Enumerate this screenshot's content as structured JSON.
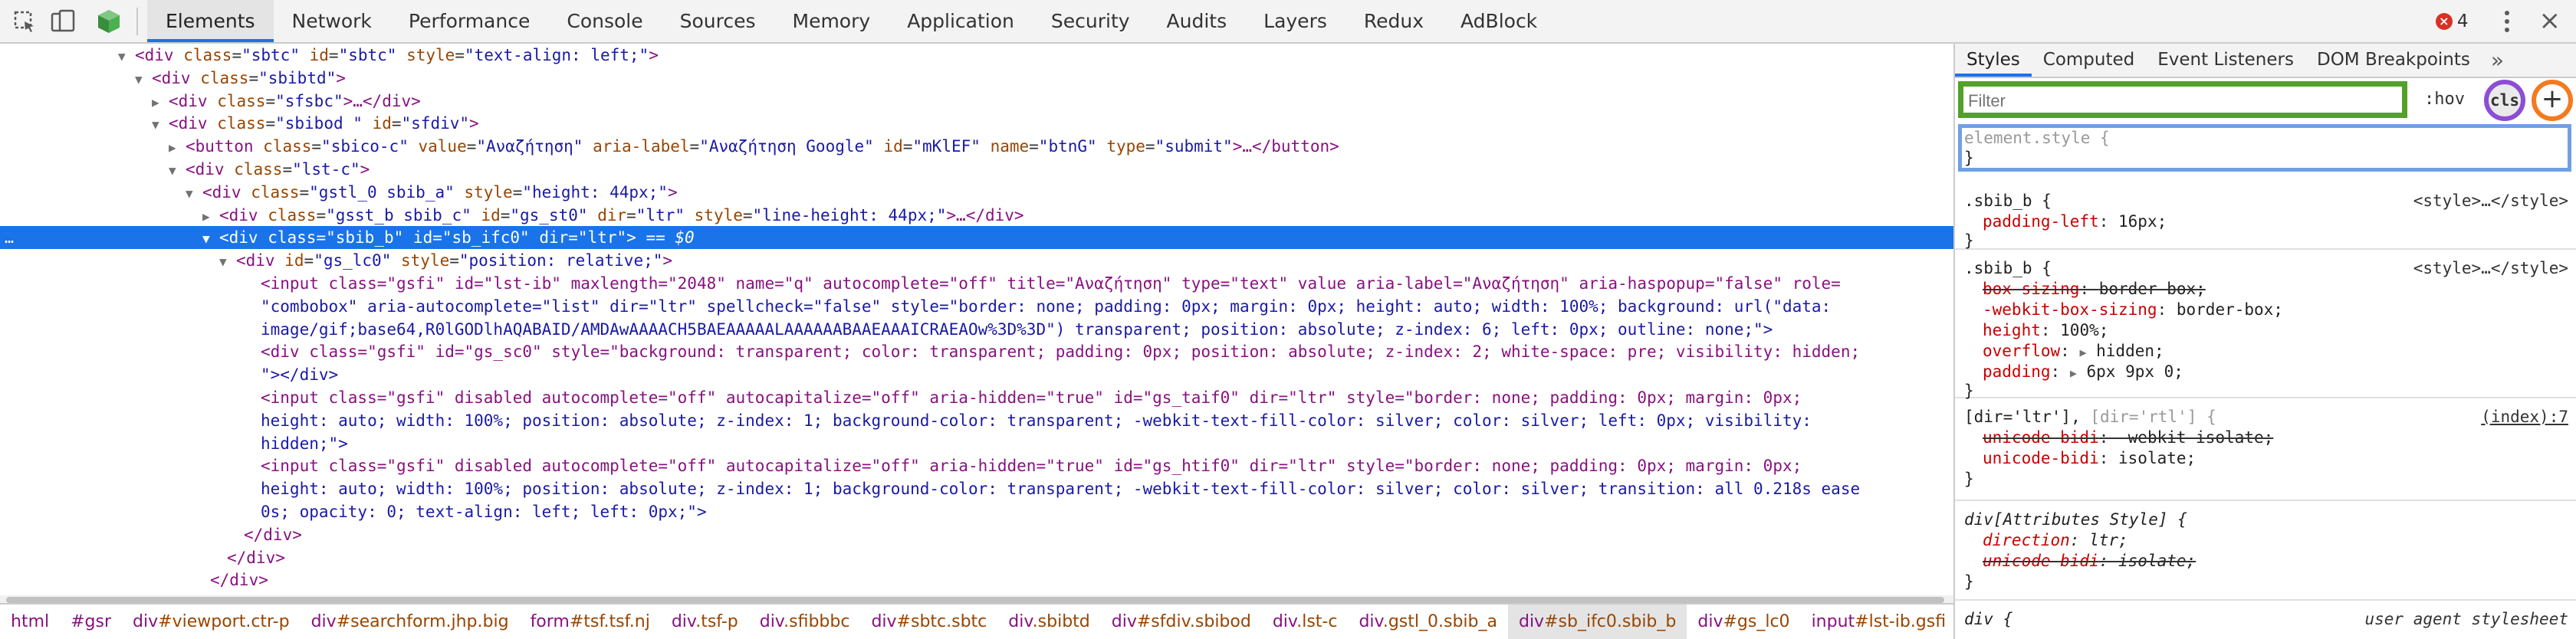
{
  "toolbar": {
    "tabs": [
      "Elements",
      "Network",
      "Performance",
      "Console",
      "Sources",
      "Memory",
      "Application",
      "Security",
      "Audits",
      "Layers",
      "Redux",
      "AdBlock"
    ],
    "active_tab": "Elements",
    "error_count": "4"
  },
  "dom": {
    "lines": [
      {
        "tag": "div",
        "attrs": [
          [
            "class",
            "sbtc"
          ],
          [
            "id",
            "sbtc"
          ],
          [
            "style",
            "text-align: left;"
          ]
        ],
        "close": ">"
      },
      {
        "tag": "div",
        "attrs": [
          [
            "class",
            "sbibtd"
          ]
        ],
        "close": ">"
      },
      {
        "tag": "div",
        "attrs": [
          [
            "class",
            "sfsbc"
          ]
        ],
        "close": ">…</div>"
      },
      {
        "tag": "div",
        "attrs": [
          [
            "class",
            "sbibod "
          ],
          [
            "id",
            "sfdiv"
          ]
        ],
        "close": ">"
      },
      {
        "tag": "button",
        "attrs": [
          [
            "class",
            "sbico-c"
          ],
          [
            "value",
            "Αναζήτηση"
          ],
          [
            "aria-label",
            "Αναζήτηση Google"
          ],
          [
            "id",
            "mKlEF"
          ],
          [
            "name",
            "btnG"
          ],
          [
            "type",
            "submit"
          ]
        ],
        "close": ">…</button>"
      },
      {
        "tag": "div",
        "attrs": [
          [
            "class",
            "lst-c"
          ]
        ],
        "close": ">"
      },
      {
        "tag": "div",
        "attrs": [
          [
            "class",
            "gstl_0 sbib_a"
          ],
          [
            "style",
            "height: 44px;"
          ]
        ],
        "close": ">"
      },
      {
        "tag": "div",
        "attrs": [
          [
            "class",
            "gsst_b sbib_c"
          ],
          [
            "id",
            "gs_st0"
          ],
          [
            "dir",
            "ltr"
          ],
          [
            "style",
            "line-height: 44px;"
          ]
        ],
        "close": ">…</div>"
      },
      {
        "tag": "div",
        "attrs": [
          [
            "class",
            "sbib_b"
          ],
          [
            "id",
            "sb_ifc0"
          ],
          [
            "dir",
            "ltr"
          ]
        ],
        "close": ">",
        "suffix": " == $0"
      },
      {
        "tag": "div",
        "attrs": [
          [
            "id",
            "gs_lc0"
          ],
          [
            "style",
            "position: relative;"
          ]
        ],
        "close": ">"
      }
    ],
    "input1": [
      "<input class=\"gsfi\" id=\"lst-ib\" maxlength=\"2048\" name=\"q\" autocomplete=\"off\" title=\"Αναζήτηση\" type=\"text\" value aria-label=\"Αναζήτηση\" aria-haspopup=\"false\" role=",
      "\"combobox\" aria-autocomplete=\"list\" dir=\"ltr\" spellcheck=\"false\" style=\"border: none; padding: 0px; margin: 0px; height: auto; width: 100%; background: url(\"data:",
      "image/gif;base64,R0lGODlhAQABAID/AMDAwAAAACH5BAEAAAAALAAAAAABAAEAAAICRAEAOw%3D%3D\") transparent; position: absolute; z-index: 6; left: 0px; outline: none;\">"
    ],
    "div_sc": [
      "<div class=\"gsfi\" id=\"gs_sc0\" style=\"background: transparent; color: transparent; padding: 0px; position: absolute; z-index: 2; white-space: pre; visibility: hidden;",
      "\"></div>"
    ],
    "input2": [
      "<input class=\"gsfi\" disabled autocomplete=\"off\" autocapitalize=\"off\" aria-hidden=\"true\" id=\"gs_taif0\" dir=\"ltr\" style=\"border: none; padding: 0px; margin: 0px;",
      "height: auto; width: 100%; position: absolute; z-index: 1; background-color: transparent; -webkit-text-fill-color: silver; color: silver; left: 0px; visibility:",
      "hidden;\">"
    ],
    "input3": [
      "<input class=\"gsfi\" disabled autocomplete=\"off\" autocapitalize=\"off\" aria-hidden=\"true\" id=\"gs_htif0\" dir=\"ltr\" style=\"border: none; padding: 0px; margin: 0px;",
      "height: auto; width: 100%; position: absolute; z-index: 1; background-color: transparent; -webkit-text-fill-color: silver; color: silver; transition: all 0.218s ease",
      "0s; opacity: 0; text-align: left; left: 0px;\">"
    ],
    "close1": "</div>",
    "close2": "</div>",
    "close3": "</div>"
  },
  "breadcrumbs": [
    {
      "tag": "html",
      "cls": ""
    },
    {
      "tag": "#gsr",
      "cls": ""
    },
    {
      "tag": "div",
      "cls": "#viewport.ctr-p"
    },
    {
      "tag": "div",
      "cls": "#searchform.jhp.big"
    },
    {
      "tag": "form",
      "cls": "#tsf.tsf.nj"
    },
    {
      "tag": "div",
      "cls": ".tsf-p"
    },
    {
      "tag": "div",
      "cls": ".sfibbbc"
    },
    {
      "tag": "div",
      "cls": "#sbtc.sbtc"
    },
    {
      "tag": "div",
      "cls": ".sbibtd"
    },
    {
      "tag": "div",
      "cls": "#sfdiv.sbibod"
    },
    {
      "tag": "div",
      "cls": ".lst-c"
    },
    {
      "tag": "div",
      "cls": ".gstl_0.sbib_a"
    },
    {
      "tag": "div",
      "cls": "#sb_ifc0.sbib_b"
    },
    {
      "tag": "div",
      "cls": "#gs_lc0"
    },
    {
      "tag": "input",
      "cls": "#lst-ib.gsfi"
    }
  ],
  "styles": {
    "tabs": [
      "Styles",
      "Computed",
      "Event Listeners",
      "DOM Breakpoints"
    ],
    "more": "»",
    "filter_placeholder": "Filter",
    "hov": ":hov",
    "cls": "cls",
    "plus": "+",
    "element_style": {
      "selector": "element.style {",
      "close": "}"
    },
    "rule1": {
      "selector": ".sbib_b {",
      "source": "<style>…</style>",
      "props": [
        {
          "name": "padding-left",
          "value": "16px;"
        }
      ],
      "close": "}"
    },
    "rule2": {
      "selector": ".sbib_b {",
      "source": "<style>…</style>",
      "props": [
        {
          "name": "box-sizing",
          "value": "border-box;",
          "struck": true
        },
        {
          "name": "-webkit-box-sizing",
          "value": "border-box;"
        },
        {
          "name": "height",
          "value": "100%;"
        },
        {
          "name": "overflow",
          "value": "hidden;",
          "caret": true
        },
        {
          "name": "padding",
          "value": "6px 9px 0;",
          "caret": true
        }
      ],
      "close": "}"
    },
    "rule3": {
      "selector1": "[dir='ltr'],",
      "selector2": " [dir='rtl'] {",
      "source": "(index):7",
      "props": [
        {
          "name": "unicode-bidi",
          "value": "-webkit-isolate;",
          "struck": true
        },
        {
          "name": "unicode-bidi",
          "value": "isolate;"
        }
      ],
      "close": "}"
    },
    "rule4": {
      "selector": "div[Attributes Style] {",
      "props": [
        {
          "name": "direction",
          "value": "ltr;"
        },
        {
          "name": "unicode-bidi",
          "value": "isolate;",
          "struck": true
        }
      ],
      "close": "}"
    },
    "rule5": {
      "selector": "div {",
      "source": "user agent stylesheet"
    }
  }
}
